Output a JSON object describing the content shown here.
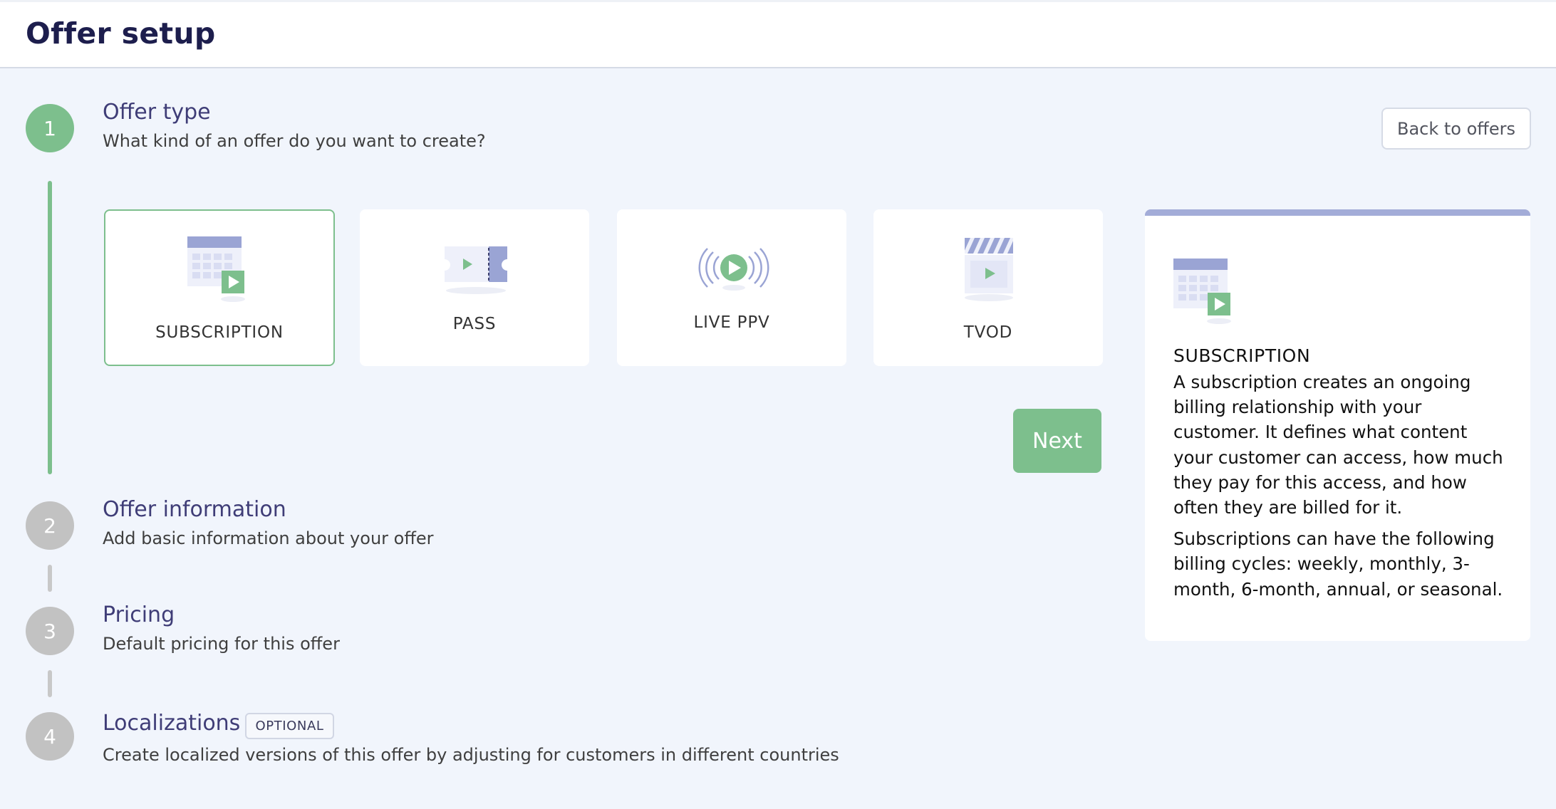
{
  "header": {
    "title": "Offer setup"
  },
  "back_button": "Back to offers",
  "steps": [
    {
      "number": "1",
      "title": "Offer type",
      "subtitle": "What kind of an offer do you want to create?"
    },
    {
      "number": "2",
      "title": "Offer information",
      "subtitle": "Add basic information about your offer"
    },
    {
      "number": "3",
      "title": "Pricing",
      "subtitle": "Default pricing for this offer"
    },
    {
      "number": "4",
      "title": "Localizations",
      "badge": "OPTIONAL",
      "subtitle": "Create localized versions of this offer by adjusting for customers in different countries"
    }
  ],
  "offer_types": [
    {
      "label": "SUBSCRIPTION",
      "icon": "calendar-play-icon",
      "selected": true
    },
    {
      "label": "PASS",
      "icon": "ticket-icon",
      "selected": false
    },
    {
      "label": "LIVE PPV",
      "icon": "broadcast-play-icon",
      "selected": false
    },
    {
      "label": "TVOD",
      "icon": "clapperboard-icon",
      "selected": false
    }
  ],
  "next_button": "Next",
  "info_panel": {
    "icon": "calendar-play-icon",
    "title": "SUBSCRIPTION",
    "paragraph1": "A subscription creates an ongoing billing relationship with your customer. It defines what content your customer can access, how much they pay for this access, and how often they are billed for it.",
    "paragraph2": "Subscriptions can have the following billing cycles: weekly, monthly, 3-month, 6-month, annual, or seasonal."
  },
  "colors": {
    "accent_green": "#7dbf8d",
    "step_title": "#3f3d77",
    "inactive_step": "#c2c2c2",
    "panel_accent": "#a3acd8"
  }
}
